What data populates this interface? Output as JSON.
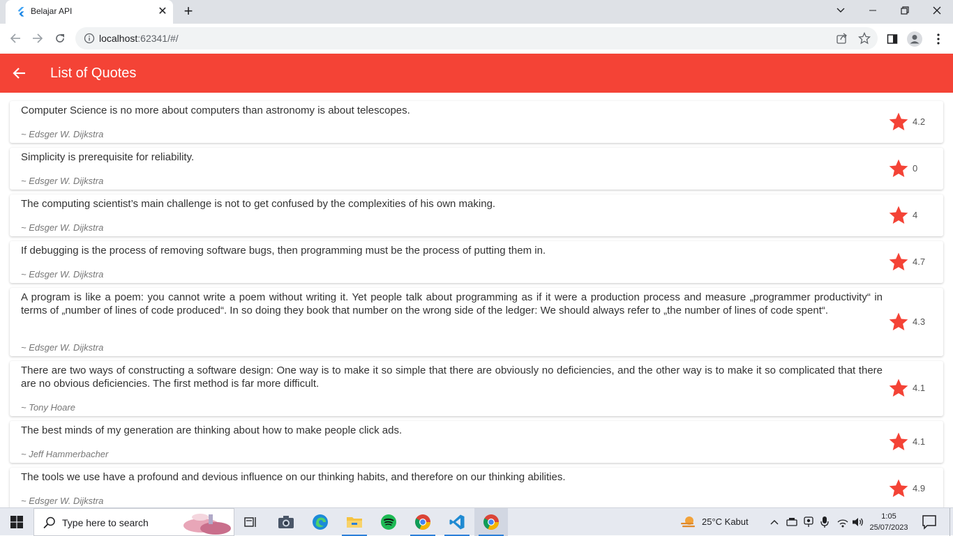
{
  "browser": {
    "tab_title": "Belajar API",
    "url_host": "localhost",
    "url_rest": ":62341/#/"
  },
  "app": {
    "title": "List of Quotes",
    "accent": "#f44336",
    "star_color": "#f44336"
  },
  "quotes": [
    {
      "text": "Computer Science is no more about computers than astronomy is about telescopes.",
      "author": "~ Edsger W. Dijkstra",
      "rating": "4.2"
    },
    {
      "text": "Simplicity is prerequisite for reliability.",
      "author": "~ Edsger W. Dijkstra",
      "rating": "0"
    },
    {
      "text": "The computing scientist’s main challenge is not to get confused by the complexities of his own making.",
      "author": "~ Edsger W. Dijkstra",
      "rating": "4"
    },
    {
      "text": "If debugging is the process of removing software bugs, then programming must be the process of putting them in.",
      "author": "~ Edsger W. Dijkstra",
      "rating": "4.7"
    },
    {
      "text": "A program is like a poem: you cannot write a poem without writing it. Yet people talk about programming as if it were a production process and measure „programmer productivity“ in terms of „number of lines of code produced“. In so doing they book that number on the wrong side of the ledger: We should always refer to „the number of lines of code spent“.",
      "author": "~ Edsger W. Dijkstra",
      "rating": "4.3"
    },
    {
      "text": "There are two ways of constructing a software design: One way is to make it so simple that there are obviously no deficiencies, and the other way is to make it so complicated that there are no obvious deficiencies. The first method is far more difficult.",
      "author": "~ Tony Hoare",
      "rating": "4.1"
    },
    {
      "text": "The best minds of my generation are thinking about how to make people click ads.",
      "author": "~ Jeff Hammerbacher",
      "rating": "4.1"
    },
    {
      "text": "The tools we use have a profound and devious influence on our thinking habits, and therefore on our thinking abilities.",
      "author": "~ Edsger W. Dijkstra",
      "rating": "4.9"
    }
  ],
  "taskbar": {
    "search_placeholder": "Type here to search",
    "weather": "25°C  Kabut",
    "time": "1:05",
    "date": "25/07/2023"
  }
}
